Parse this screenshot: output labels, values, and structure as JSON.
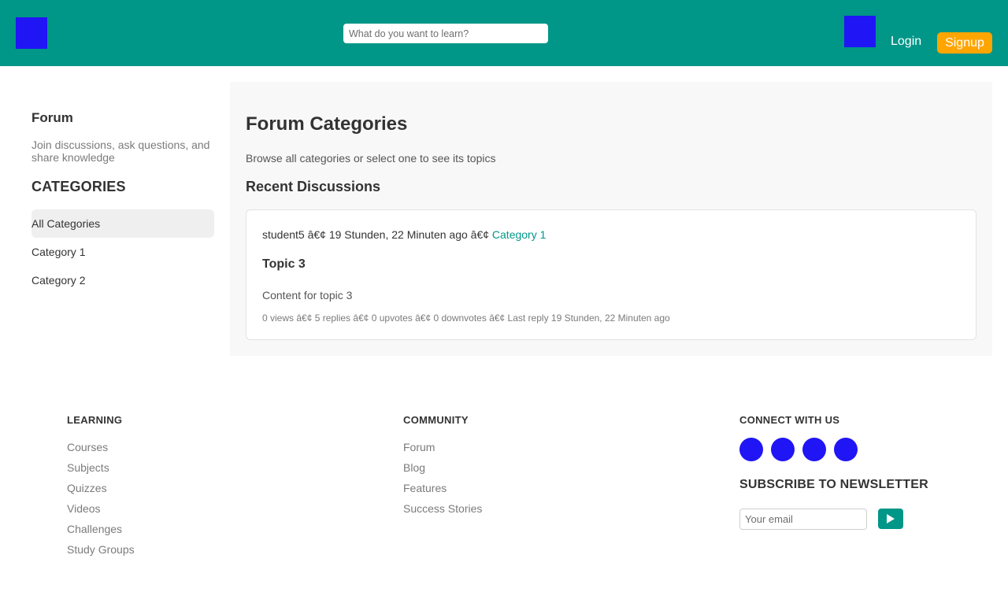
{
  "header": {
    "search_placeholder": "What do you want to learn?",
    "login_label": "Login",
    "signup_label": "Signup"
  },
  "sidebar": {
    "title": "Forum",
    "description": "Join discussions, ask questions, and share knowledge",
    "categories_heading": "CATEGORIES",
    "items": [
      {
        "label": "All Categories",
        "active": true
      },
      {
        "label": "Category 1",
        "active": false
      },
      {
        "label": "Category 2",
        "active": false
      }
    ]
  },
  "main": {
    "title": "Forum Categories",
    "subtitle": "Browse all categories or select one to see its topics",
    "recent_heading": "Recent Discussions",
    "discussion": {
      "meta": "student5 â€¢ 19 Stunden, 22 Minuten ago â€¢",
      "category": "Category 1",
      "title": "Topic 3",
      "content": "Content for topic 3",
      "stats": "0 views â€¢ 5 replies â€¢ 0 upvotes â€¢ 0 downvotes â€¢ Last reply 19 Stunden, 22 Minuten ago"
    }
  },
  "footer": {
    "learning": {
      "heading": "LEARNING",
      "links": [
        "Courses",
        "Subjects",
        "Quizzes",
        "Videos",
        "Challenges",
        "Study Groups"
      ]
    },
    "community": {
      "heading": "COMMUNITY",
      "links": [
        "Forum",
        "Blog",
        "Features",
        "Success Stories"
      ]
    },
    "connect": {
      "heading": "CONNECT WITH US",
      "newsletter_heading": "SUBSCRIBE TO NEWSLETTER",
      "email_placeholder": "Your email"
    }
  },
  "colors": {
    "header_bg": "#009688",
    "accent": "#009688",
    "signup_bg": "#ffa500",
    "icon_placeholder": "#2015f5"
  },
  "icons": {
    "logo": "logo-icon",
    "user": "user-icon",
    "social": [
      "social-icon-1",
      "social-icon-2",
      "social-icon-3",
      "social-icon-4"
    ],
    "send": "send-arrow-icon"
  }
}
